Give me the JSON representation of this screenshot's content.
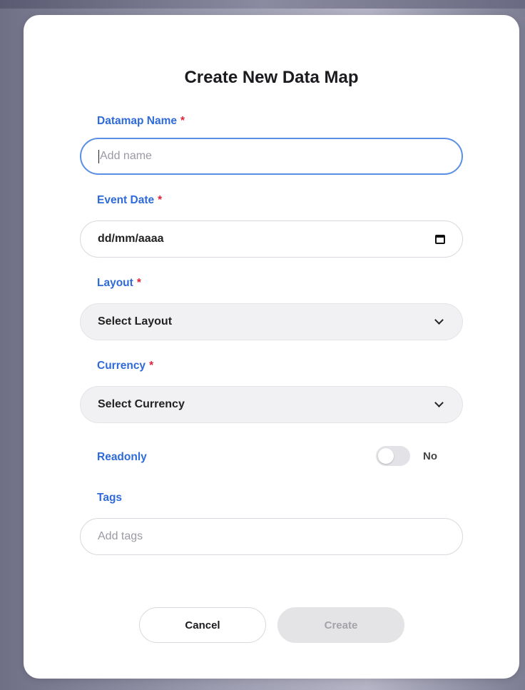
{
  "modal": {
    "title": "Create New Data Map"
  },
  "fields": {
    "datamap_name": {
      "label": "Datamap Name",
      "required_mark": "*",
      "value": "",
      "placeholder": "Add name"
    },
    "event_date": {
      "label": "Event Date",
      "required_mark": "*",
      "value": "dd/mm/aaaa",
      "icon": "calendar-icon"
    },
    "layout": {
      "label": "Layout",
      "required_mark": "*",
      "selected": "Select Layout",
      "icon": "chevron-down-icon"
    },
    "currency": {
      "label": "Currency",
      "required_mark": "*",
      "selected": "Select Currency",
      "icon": "chevron-down-icon"
    },
    "readonly": {
      "label": "Readonly",
      "state_text": "No",
      "checked": false
    },
    "tags": {
      "label": "Tags",
      "value": "",
      "placeholder": "Add tags"
    }
  },
  "actions": {
    "cancel_label": "Cancel",
    "create_label": "Create",
    "create_disabled": true
  },
  "colors": {
    "label_blue": "#2f6ad9",
    "required_red": "#e0243a",
    "focus_border": "#5b8fe4",
    "disabled_button": "#e4e4e6"
  }
}
